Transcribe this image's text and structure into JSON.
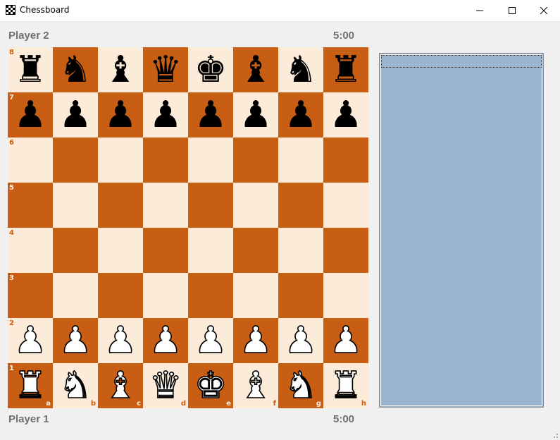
{
  "window": {
    "title": "Chessboard",
    "icon": "checkerboard-icon"
  },
  "controls": {
    "minimize": "minimize-icon",
    "maximize": "maximize-icon",
    "close": "close-icon"
  },
  "players": {
    "top": {
      "name": "Player 2",
      "clock": "5:00"
    },
    "bottom": {
      "name": "Player 1",
      "clock": "5:00"
    }
  },
  "colors": {
    "light_square": "#fbebd8",
    "dark_square": "#c85e13",
    "move_list_bg": "#99b3d0"
  },
  "board": {
    "files": [
      "a",
      "b",
      "c",
      "d",
      "e",
      "f",
      "g",
      "h"
    ],
    "ranks": [
      "8",
      "7",
      "6",
      "5",
      "4",
      "3",
      "2",
      "1"
    ],
    "position": [
      [
        "bR",
        "bN",
        "bB",
        "bQ",
        "bK",
        "bB",
        "bN",
        "bR"
      ],
      [
        "bP",
        "bP",
        "bP",
        "bP",
        "bP",
        "bP",
        "bP",
        "bP"
      ],
      [
        "",
        "",
        "",
        "",
        "",
        "",
        "",
        ""
      ],
      [
        "",
        "",
        "",
        "",
        "",
        "",
        "",
        ""
      ],
      [
        "",
        "",
        "",
        "",
        "",
        "",
        "",
        ""
      ],
      [
        "",
        "",
        "",
        "",
        "",
        "",
        "",
        ""
      ],
      [
        "wP",
        "wP",
        "wP",
        "wP",
        "wP",
        "wP",
        "wP",
        "wP"
      ],
      [
        "wR",
        "wN",
        "wB",
        "wQ",
        "wK",
        "wB",
        "wN",
        "wR"
      ]
    ]
  },
  "move_list": {
    "moves": []
  }
}
